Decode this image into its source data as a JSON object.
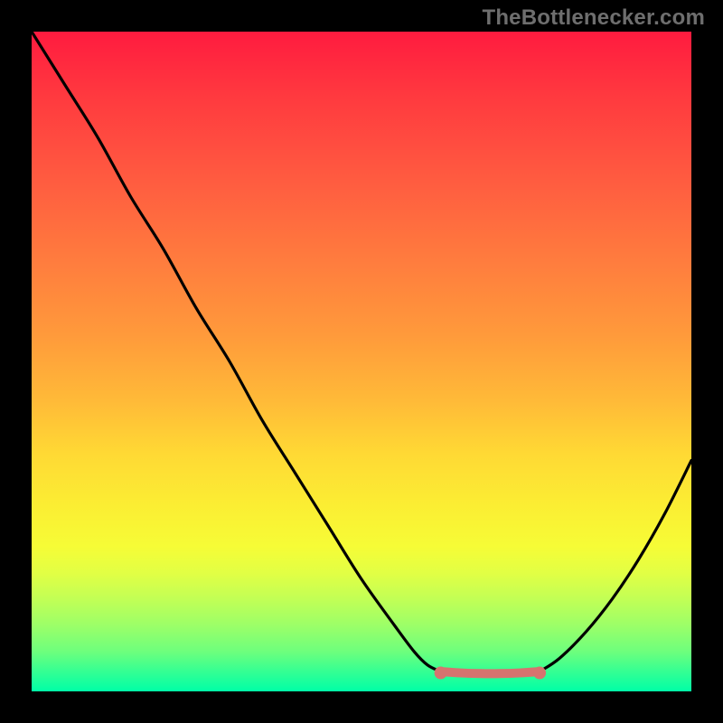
{
  "watermark": "TheBottlenecker.com",
  "chart_data": {
    "type": "line",
    "title": "",
    "xlabel": "",
    "ylabel": "",
    "xlim": [
      0,
      1
    ],
    "ylim": [
      0,
      1
    ],
    "series": [
      {
        "name": "left-descending-curve",
        "x": [
          0.0,
          0.05,
          0.1,
          0.15,
          0.2,
          0.25,
          0.3,
          0.35,
          0.4,
          0.45,
          0.5,
          0.55,
          0.58,
          0.6,
          0.62
        ],
        "y": [
          1.0,
          0.92,
          0.84,
          0.75,
          0.67,
          0.58,
          0.5,
          0.41,
          0.33,
          0.25,
          0.17,
          0.1,
          0.06,
          0.04,
          0.03
        ]
      },
      {
        "name": "valley-flat-highlight",
        "x": [
          0.62,
          0.65,
          0.68,
          0.71,
          0.74,
          0.77
        ],
        "y": [
          0.03,
          0.028,
          0.027,
          0.027,
          0.028,
          0.03
        ]
      },
      {
        "name": "right-ascending-curve",
        "x": [
          0.77,
          0.8,
          0.84,
          0.88,
          0.92,
          0.96,
          1.0
        ],
        "y": [
          0.03,
          0.05,
          0.09,
          0.14,
          0.2,
          0.27,
          0.35
        ]
      }
    ],
    "highlight": {
      "name": "optimal-range",
      "x_start": 0.62,
      "x_end": 0.77,
      "y": 0.028
    },
    "background_gradient": {
      "top_color": "#ff1b3f",
      "bottom_color": "#00ffa7",
      "meaning": "red=high bottleneck, green=low bottleneck"
    }
  }
}
